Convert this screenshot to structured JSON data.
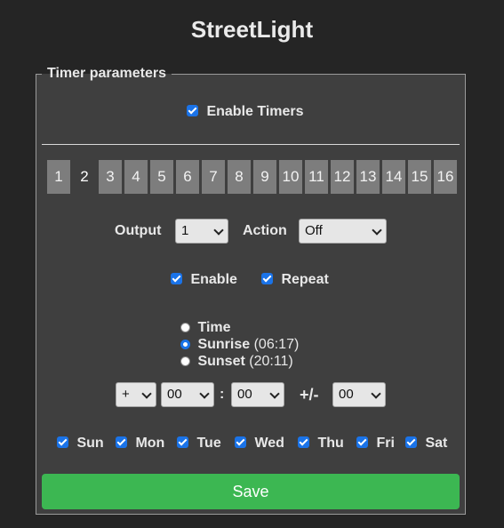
{
  "app_title": "StreetLight",
  "fieldset_legend": "Timer parameters",
  "enable_timers": {
    "label": "Enable Timers",
    "checked": true
  },
  "timer_tabs": [
    "1",
    "2",
    "3",
    "4",
    "5",
    "6",
    "7",
    "8",
    "9",
    "10",
    "11",
    "12",
    "13",
    "14",
    "15",
    "16"
  ],
  "active_tab": "2",
  "output": {
    "label": "Output",
    "value": "1"
  },
  "action": {
    "label": "Action",
    "value": "Off"
  },
  "enable": {
    "label": "Enable",
    "checked": true
  },
  "repeat": {
    "label": "Repeat",
    "checked": true
  },
  "trigger": {
    "time_label": "Time",
    "sunrise_label": "Sunrise",
    "sunrise_time": "(06:17)",
    "sunset_label": "Sunset",
    "sunset_time": "(20:11)",
    "selected": "Sunrise"
  },
  "offset": {
    "sign": "+",
    "hours": "00",
    "separator": ":",
    "minutes": "00",
    "jitter_label": "+/-",
    "jitter": "00"
  },
  "days": [
    {
      "label": "Sun",
      "checked": true
    },
    {
      "label": "Mon",
      "checked": true
    },
    {
      "label": "Tue",
      "checked": true
    },
    {
      "label": "Wed",
      "checked": true
    },
    {
      "label": "Thu",
      "checked": true
    },
    {
      "label": "Fri",
      "checked": true
    },
    {
      "label": "Sat",
      "checked": true
    }
  ],
  "save_label": "Save",
  "colors": {
    "accent": "#1a73e8",
    "save": "#3cb752",
    "panel": "#3f3f3f",
    "background": "#252525"
  }
}
